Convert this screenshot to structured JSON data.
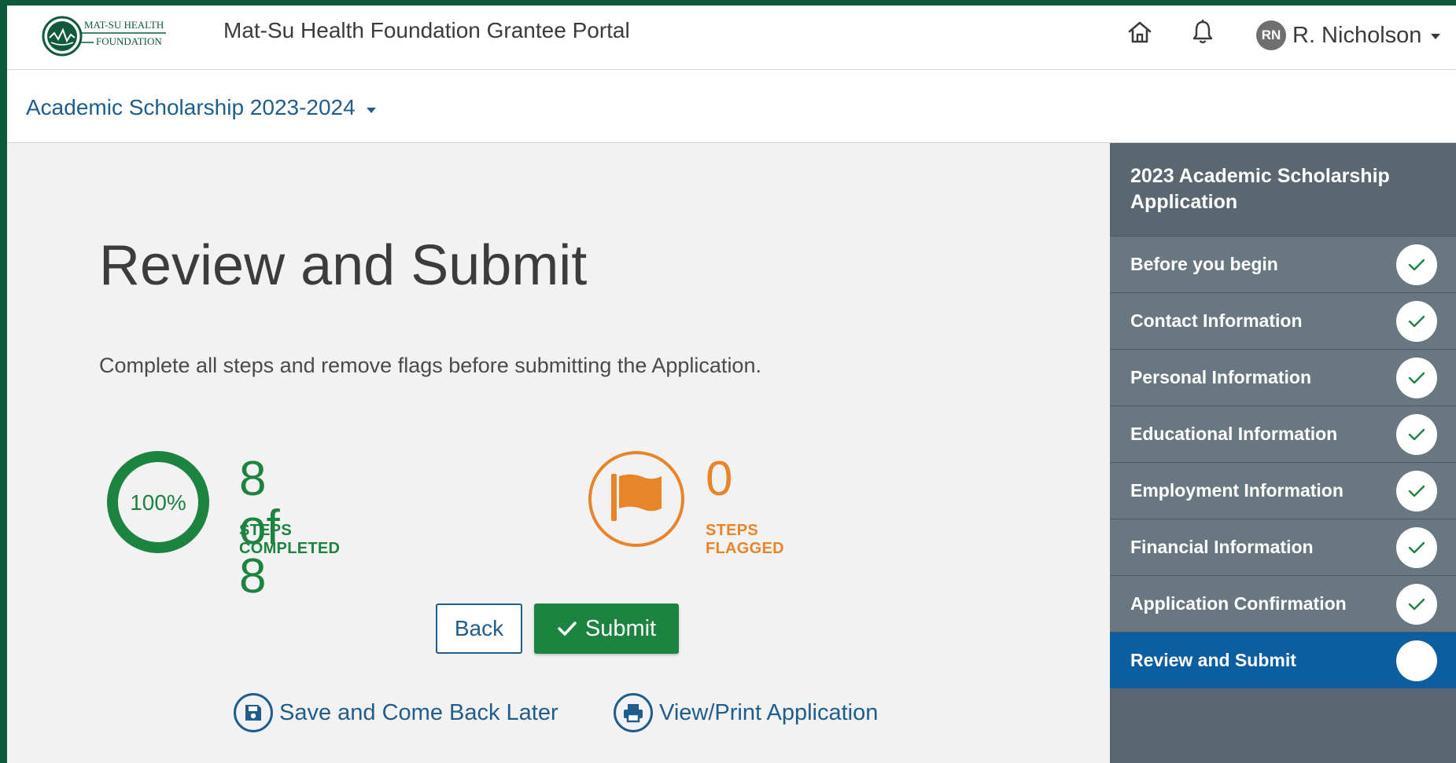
{
  "header": {
    "logo_text_line1": "MAT-SU HEALTH",
    "logo_text_line2": "FOUNDATION",
    "portal_title": "Mat-Su Health Foundation Grantee Portal",
    "user_initials": "RN",
    "user_name": "R. Nicholson"
  },
  "subheader": {
    "program": "Academic Scholarship 2023-2024"
  },
  "main": {
    "title": "Review and Submit",
    "instructions": "Complete all steps and remove flags before submitting the Application.",
    "completed": {
      "percent_label": "100%",
      "percent_value": 100,
      "count": "8 of 8",
      "label": "STEPS COMPLETED",
      "color": "#1d8340"
    },
    "flagged": {
      "count": "0",
      "label": "STEPS FLAGGED",
      "color": "#e8842a"
    },
    "back_label": "Back",
    "submit_label": "Submit",
    "save_label": "Save and Come Back Later",
    "print_label": "View/Print Application"
  },
  "sidebar": {
    "title": "2023 Academic Scholarship Application",
    "steps": [
      {
        "label": "Before you begin",
        "complete": true
      },
      {
        "label": "Contact Information",
        "complete": true
      },
      {
        "label": "Personal Information",
        "complete": true
      },
      {
        "label": "Educational Information",
        "complete": true
      },
      {
        "label": "Employment Information",
        "complete": true
      },
      {
        "label": "Financial Information",
        "complete": true
      },
      {
        "label": "Application Confirmation",
        "complete": true
      },
      {
        "label": "Review and Submit",
        "complete": false,
        "active": true
      }
    ]
  },
  "colors": {
    "brand_green": "#1d8340",
    "link_blue": "#1f5d8c",
    "flag_orange": "#e8842a",
    "sidebar_bg": "#5b6770",
    "sidebar_active": "#0c5ea1"
  }
}
